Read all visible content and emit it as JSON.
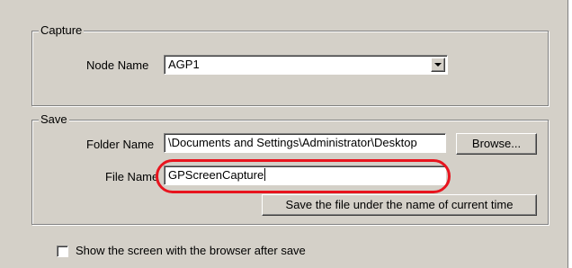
{
  "capture_group": {
    "legend": "Capture",
    "node_name_label": "Node Name",
    "node_name_value": "AGP1"
  },
  "save_group": {
    "legend": "Save",
    "folder_name_label": "Folder Name",
    "folder_name_value": "\\Documents and Settings\\Administrator\\Desktop",
    "browse_label": "Browse...",
    "file_name_label": "File Name",
    "file_name_value": "GPScreenCapture",
    "save_current_time_label": "Save the file under the name of current time"
  },
  "show_browser_checkbox": {
    "label": "Show the screen with the browser after save",
    "checked": false
  },
  "colors": {
    "dialog_background": "#d4d0c8",
    "highlight_ring": "#e8141e"
  }
}
